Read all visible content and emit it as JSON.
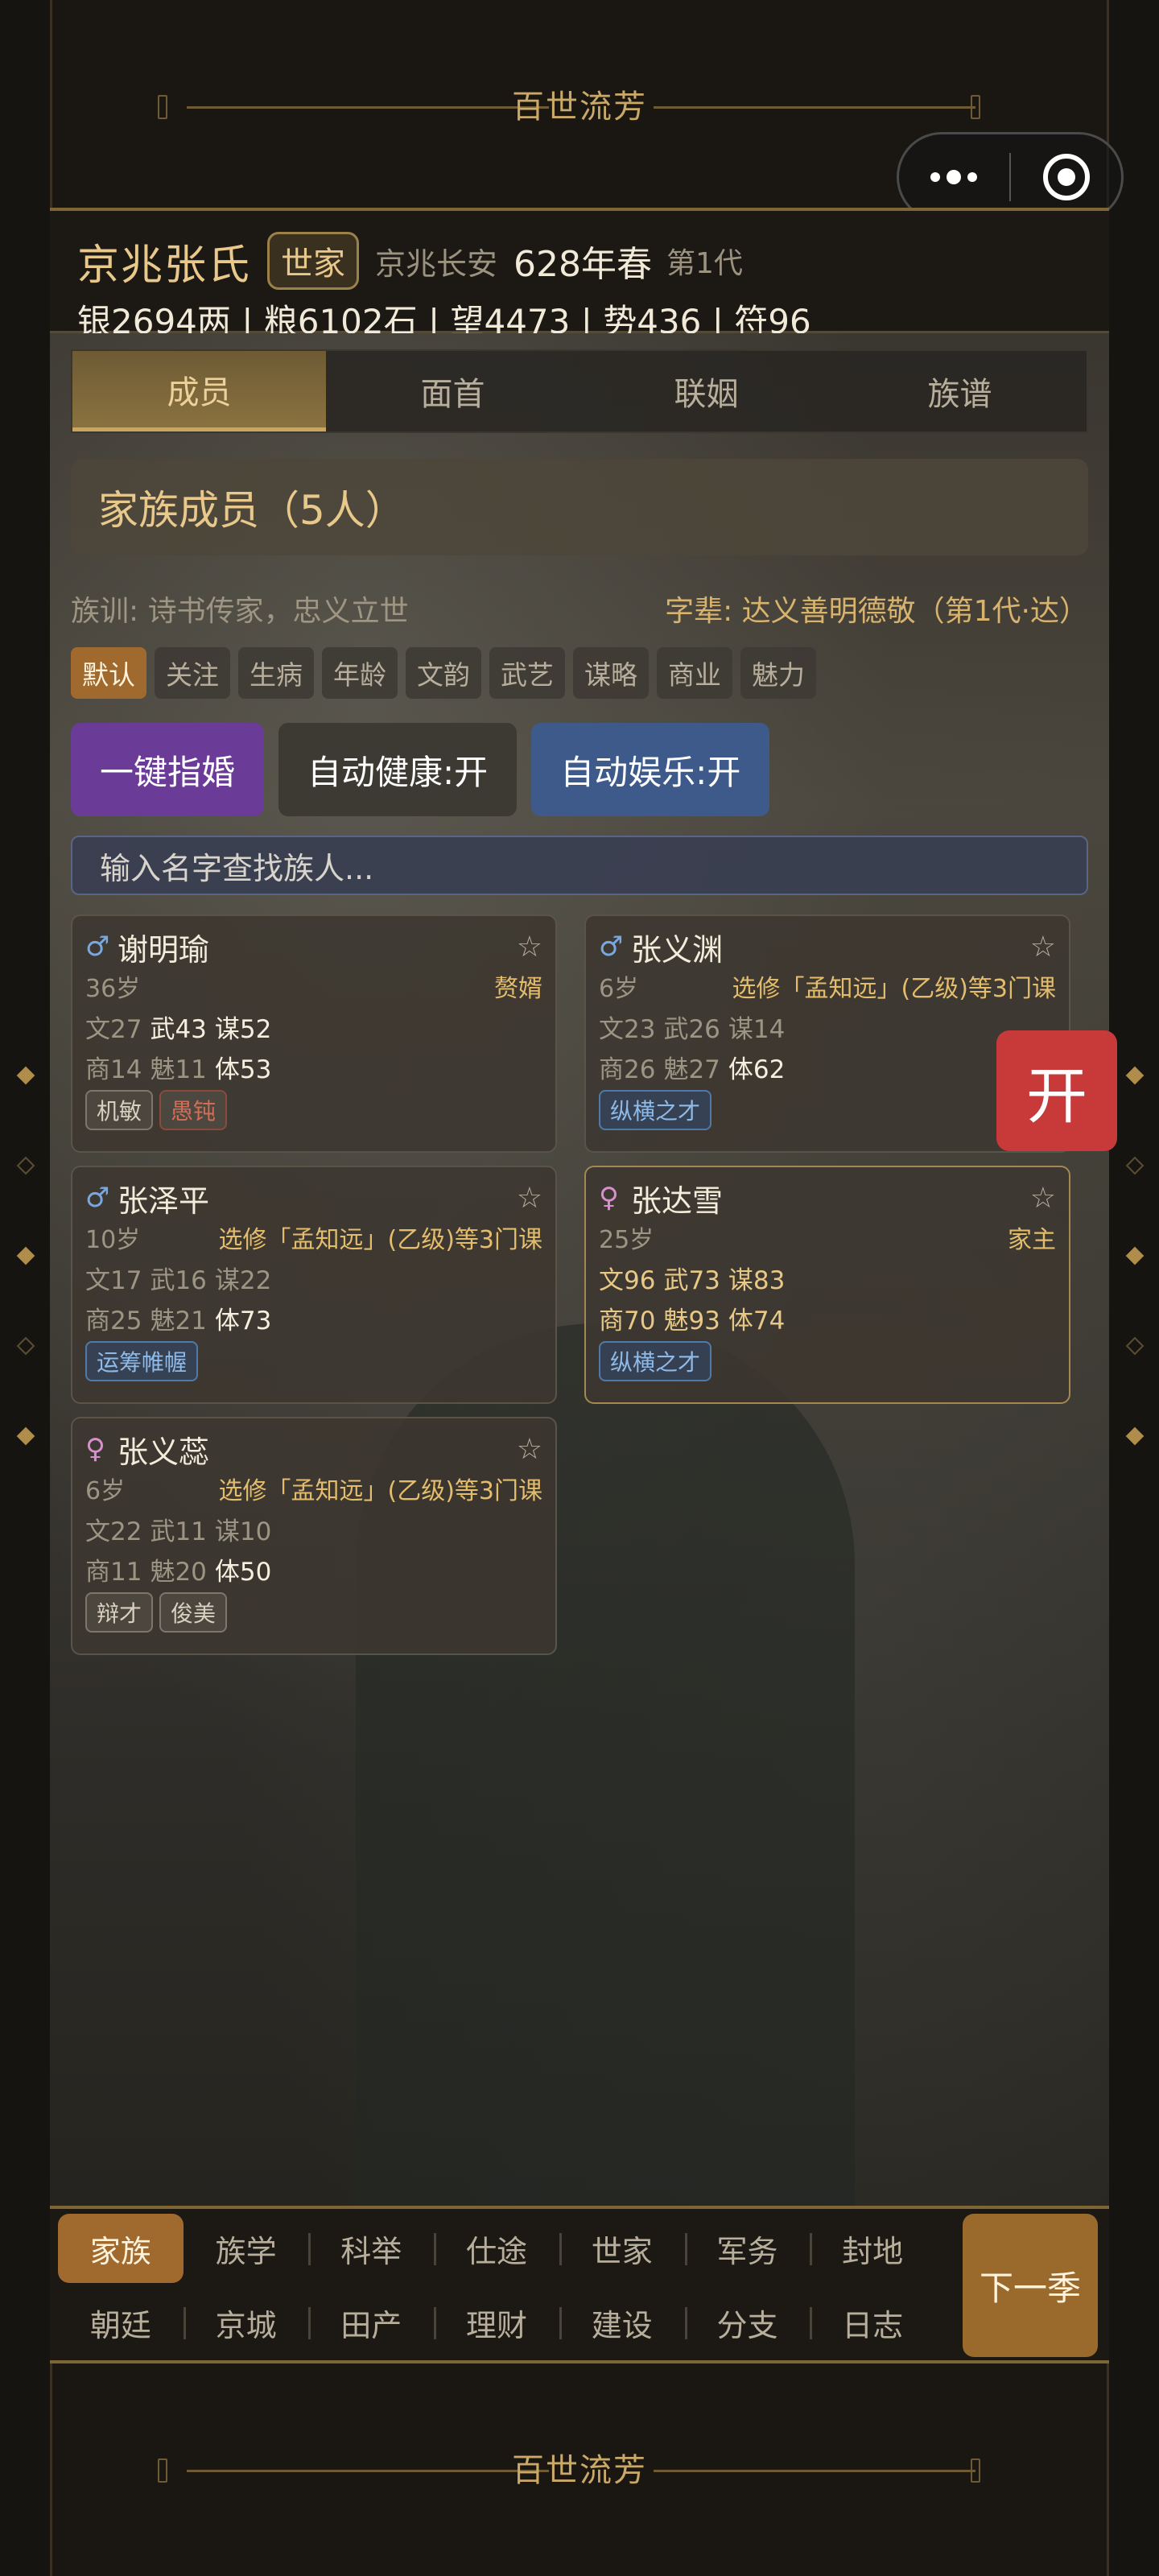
{
  "banner_title": "百世流芳",
  "header": {
    "clan_name": "京兆张氏",
    "clan_rank": "世家",
    "location": "京兆长安",
    "year": "628年春",
    "generation": "第1代",
    "resources": "银2694两 | 粮6102石 | 望4473 | 势436 | 符96"
  },
  "tabs": [
    "成员",
    "面首",
    "联姻",
    "族谱"
  ],
  "section_title": "家族成员（5人）",
  "motto": "族训: 诗书传家，忠义立世",
  "zibei": "字辈: 达义善明德敬（第1代·达）",
  "filters": [
    "默认",
    "关注",
    "生病",
    "年龄",
    "文韵",
    "武艺",
    "谋略",
    "商业",
    "魅力"
  ],
  "actions": {
    "auto_marry": "一键指婚",
    "auto_health": "自动健康:开",
    "auto_fun": "自动娱乐:开"
  },
  "search_placeholder": "输入名字查找族人...",
  "members": [
    {
      "sex": "♂",
      "name": "谢明瑜",
      "age": "36岁",
      "note": "赘婿",
      "wen": "文27",
      "wu": "武43",
      "mou": "谋52",
      "shang": "商14",
      "mei": "魅11",
      "ti": "体53",
      "tags": [
        "机敏",
        "愚钝"
      ]
    },
    {
      "sex": "♂",
      "name": "张义渊",
      "age": "6岁",
      "note": "选修「孟知远」(乙级)等3门课",
      "wen": "文23",
      "wu": "武26",
      "mou": "谋14",
      "shang": "商26",
      "mei": "魅27",
      "ti": "体62",
      "tags": [
        "纵横之才"
      ]
    },
    {
      "sex": "♂",
      "name": "张泽平",
      "age": "10岁",
      "note": "选修「孟知远」(乙级)等3门课",
      "wen": "文17",
      "wu": "武16",
      "mou": "谋22",
      "shang": "商25",
      "mei": "魅21",
      "ti": "体73",
      "tags": [
        "运筹帷幄"
      ]
    },
    {
      "sex": "♀",
      "name": "张达雪",
      "age": "25岁",
      "note": "家主",
      "wen": "文96",
      "wu": "武73",
      "mou": "谋83",
      "shang": "商70",
      "mei": "魅93",
      "ti": "体74",
      "tags": [
        "纵横之才"
      ]
    },
    {
      "sex": "♀",
      "name": "张义蕊",
      "age": "6岁",
      "note": "选修「孟知远」(乙级)等3门课",
      "wen": "文22",
      "wu": "武11",
      "mou": "谋10",
      "shang": "商11",
      "mei": "魅20",
      "ti": "体50",
      "tags": [
        "辩才",
        "俊美"
      ]
    }
  ],
  "star": "☆",
  "open_button": "开",
  "bottom_nav": {
    "row1": [
      "家族",
      "族学",
      "科举",
      "仕途",
      "世家",
      "军务",
      "封地"
    ],
    "row2": [
      "朝廷",
      "京城",
      "田产",
      "理财",
      "建设",
      "分支",
      "日志"
    ],
    "next_label": "下一季"
  },
  "icons": {
    "more": "more-dots-icon",
    "close": "target-close-icon",
    "star": "star-outline-icon"
  },
  "colors": {
    "accent_gold": "#e9c98b",
    "active_orange": "#a06a2e",
    "open_red": "#c8393a",
    "purple": "#6a3c98",
    "blue": "#3d5a8a"
  }
}
